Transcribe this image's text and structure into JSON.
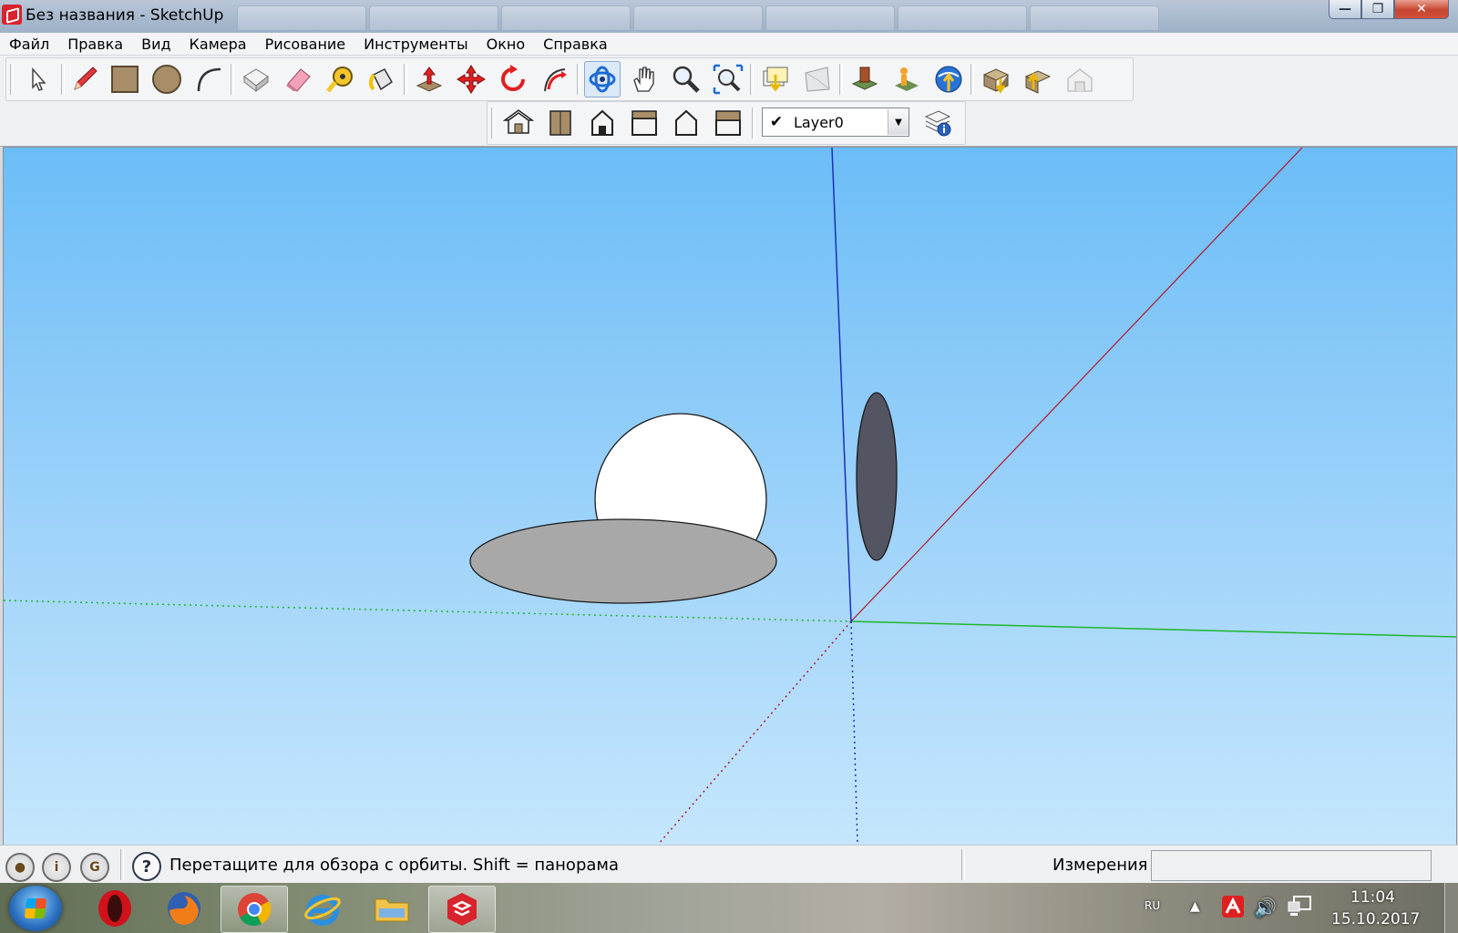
{
  "window": {
    "title": "Без названия - SketchUp",
    "controls": {
      "minimize": "—",
      "restore": "❐",
      "close": "✕"
    }
  },
  "menu": {
    "items": [
      "Файл",
      "Правка",
      "Вид",
      "Камера",
      "Рисование",
      "Инструменты",
      "Окно",
      "Справка"
    ]
  },
  "toolbar": {
    "tools": [
      {
        "icon": "select-arrow-icon"
      },
      {
        "icon": "pencil-line-icon"
      },
      {
        "icon": "rectangle-icon"
      },
      {
        "icon": "circle-icon"
      },
      {
        "icon": "arc-icon"
      },
      {
        "icon": "make-component-icon"
      },
      {
        "icon": "eraser-icon"
      },
      {
        "icon": "tape-measure-icon"
      },
      {
        "icon": "paint-bucket-icon"
      },
      {
        "icon": "push-pull-icon"
      },
      {
        "icon": "move-icon"
      },
      {
        "icon": "rotate-icon"
      },
      {
        "icon": "follow-me-icon"
      },
      {
        "icon": "orbit-icon"
      },
      {
        "icon": "pan-hand-icon"
      },
      {
        "icon": "zoom-icon"
      },
      {
        "icon": "zoom-extents-icon"
      },
      {
        "icon": "get-models-icon"
      },
      {
        "icon": "share-model-icon"
      },
      {
        "icon": "add-location-icon"
      },
      {
        "icon": "toggle-terrain-icon"
      },
      {
        "icon": "google-earth-icon"
      },
      {
        "icon": "get-models-warehouse-icon"
      },
      {
        "icon": "share-component-icon"
      },
      {
        "icon": "extension-warehouse-icon"
      }
    ],
    "active_tool": "orbit-icon",
    "views": [
      {
        "icon": "iso-view-icon"
      },
      {
        "icon": "top-view-icon"
      },
      {
        "icon": "front-view-icon"
      },
      {
        "icon": "right-view-icon"
      },
      {
        "icon": "back-view-icon"
      },
      {
        "icon": "left-view-icon"
      }
    ],
    "layer": {
      "checked": "✔",
      "name": "Layer0",
      "dropdown": "▼"
    },
    "layer_manager_icon": "layer-manager-icon"
  },
  "viewport": {
    "sky_colors": [
      "#6cbdf7",
      "#c5e6fc"
    ],
    "axes": {
      "red": "#b0162b",
      "green": "#1fb52a",
      "blue": "#1a2fb8"
    },
    "objects": [
      {
        "name": "sphere",
        "fill": "#ffffff"
      },
      {
        "name": "disc-horizontal",
        "fill": "#a8a8a8"
      },
      {
        "name": "disc-vertical",
        "fill": "#535563"
      }
    ]
  },
  "status": {
    "icons": [
      "geo-location-icon",
      "credits-icon",
      "user-icon"
    ],
    "help_icon": "?",
    "text": "Перетащите для обзора с орбиты.  Shift = панорама",
    "measurements_label": "Измерения",
    "measurements_value": ""
  },
  "taskbar": {
    "apps": [
      "opera-icon",
      "firefox-icon",
      "chrome-icon",
      "internet-explorer-icon",
      "file-explorer-icon",
      "sketchup-icon"
    ],
    "active_app": "sketchup-icon",
    "language": "RU",
    "time": "11:04",
    "date": "15.10.2017"
  }
}
